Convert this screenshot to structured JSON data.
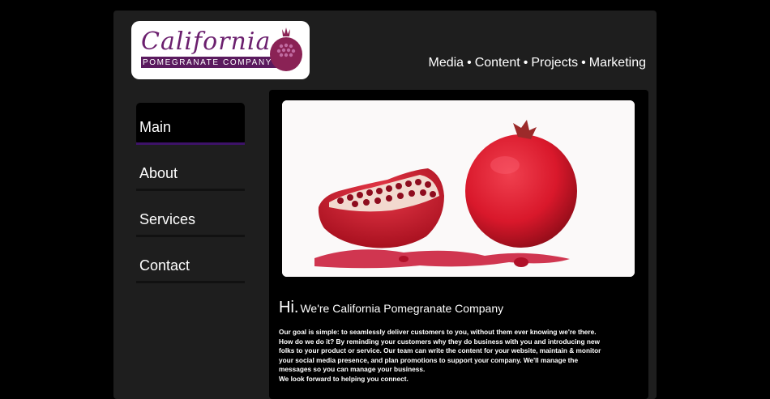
{
  "logo": {
    "script_text": "California",
    "company_text": "POMEGRANATE COMPANY"
  },
  "top_nav": [
    "Media",
    "Content",
    "Projects",
    "Marketing"
  ],
  "side_nav": {
    "items": [
      {
        "label": "Main"
      },
      {
        "label": "About"
      },
      {
        "label": "Services"
      },
      {
        "label": "Contact"
      }
    ],
    "active": "Main"
  },
  "main": {
    "greeting_hi": "Hi.",
    "greeting_rest": "We're California Pomegranate Company",
    "paragraph1": "Our goal is simple: to seamlessly deliver customers to you, without them ever knowing we're there. How do we do it? By reminding your customers why they do business with you and introducing new folks to your product or service. Our team can write the content for your website, maintain & monitor your social media presence, and plan promotions to support your company. We'll manage the messages so you can manage your business.",
    "paragraph2": "We look forward to helping you connect."
  },
  "colors": {
    "brand_purple": "#5a1a5e",
    "active_rule": "#3d1268",
    "pomegranate_red": "#d9182b"
  }
}
